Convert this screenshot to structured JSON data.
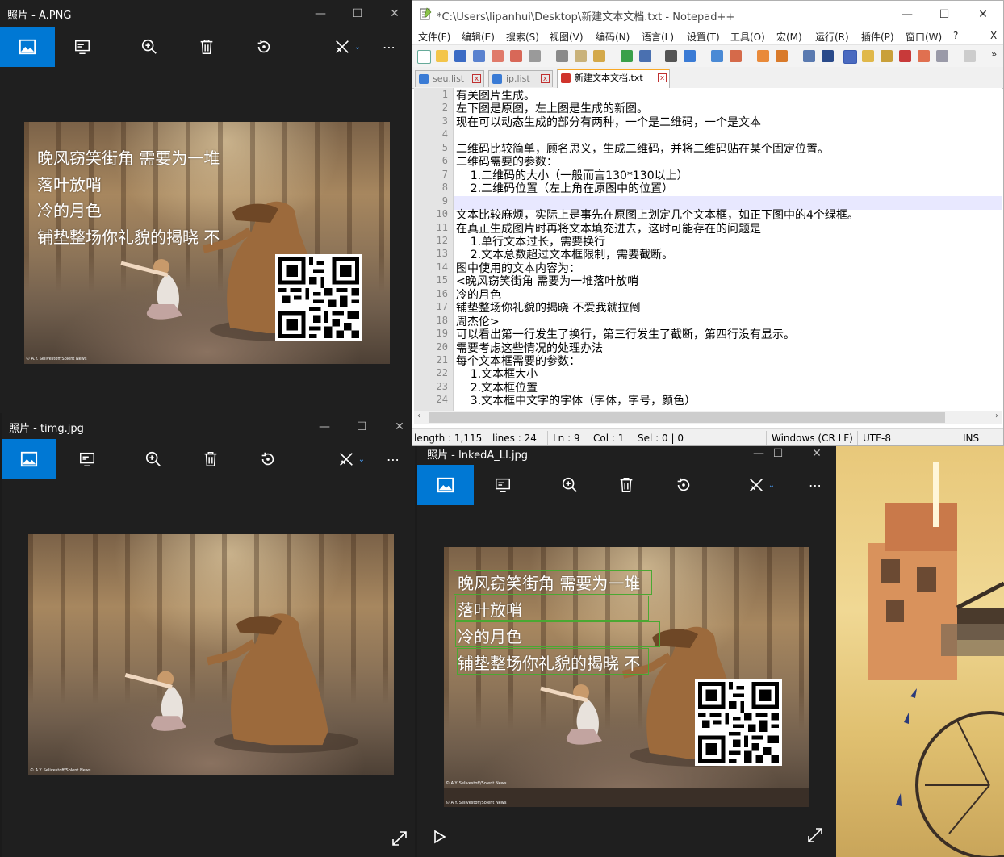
{
  "windows": {
    "photo_a": {
      "title": "照片 - A.PNG",
      "caption_lines": [
        "晚风窃笑街角 需要为一堆",
        "落叶放哨",
        "冷的月色",
        "铺垫整场你礼貌的揭晓 不"
      ],
      "credit": "© A.Y. Selivestoff/Solent News"
    },
    "photo_timg": {
      "title": "照片 - timg.jpg",
      "credit": "© A.Y. Selivestoff/Solent News"
    },
    "photo_inked": {
      "title": "照片 - InkedA_LI.jpg",
      "caption_lines": [
        "晚风窃笑街角 需要为一堆",
        "落叶放哨",
        "冷的月色",
        "铺垫整场你礼貌的揭晓 不"
      ],
      "credit": "© A.Y. Selivestoff/Solent News"
    },
    "window_controls": {
      "minimize": "—",
      "maximize": "☐",
      "close": "✕"
    }
  },
  "toolbar_icons": [
    "image-icon",
    "slideshow-icon",
    "zoom-icon",
    "delete-icon",
    "rotate-icon",
    "edit-icon",
    "more-icon"
  ],
  "notepad": {
    "title": "*C:\\Users\\lipanhui\\Desktop\\新建文本文档.txt - Notepad++",
    "menu": [
      "文件(F)",
      "编辑(E)",
      "搜索(S)",
      "视图(V)",
      "编码(N)",
      "语言(L)",
      "设置(T)",
      "工具(O)",
      "宏(M)",
      "运行(R)",
      "插件(P)",
      "窗口(W)",
      "?"
    ],
    "menu_close": "X",
    "tabs": [
      "seu.list",
      "ip.list",
      "新建文本文档.txt"
    ],
    "lines": [
      "有关图片生成。",
      "左下图是原图，左上图是生成的新图。",
      "现在可以动态生成的部分有两种，一个是二维码，一个是文本",
      "",
      "二维码比较简单，顾名思义，生成二维码，并将二维码贴在某个固定位置。",
      "二维码需要的参数：",
      "    1.二维码的大小（一般而言130*130以上）",
      "    2.二维码位置（左上角在原图中的位置）",
      "",
      "文本比较麻烦，实际上是事先在原图上划定几个文本框，如正下图中的4个绿框。",
      "在真正生成图片时再将文本填充进去，这时可能存在的问题是",
      "    1.单行文本过长，需要换行",
      "    2.文本总数超过文本框限制，需要截断。",
      "图中使用的文本内容为：",
      "<晚风窃笑街角 需要为一堆落叶放哨",
      "冷的月色",
      "铺垫整场你礼貌的揭晓 不爱我就拉倒",
      "周杰伦>",
      "可以看出第一行发生了换行，第三行发生了截断，第四行没有显示。",
      "需要考虑这些情况的处理办法",
      "每个文本框需要的参数：",
      "    1.文本框大小",
      "    2.文本框位置",
      "    3.文本框中文字的字体（字体，字号，颜色）"
    ],
    "line_numbers": [
      "1",
      "2",
      "3",
      "4",
      "5",
      "6",
      "7",
      "8",
      "9",
      "10",
      "11",
      "12",
      "13",
      "14",
      "15",
      "16",
      "17",
      "18",
      "19",
      "20",
      "21",
      "22",
      "23",
      "24"
    ],
    "status": {
      "length": "length : 1,115",
      "lines": "lines : 24",
      "ln": "Ln : 9",
      "col": "Col : 1",
      "sel": "Sel : 0 | 0",
      "eol": "Windows (CR LF)",
      "encoding": "UTF-8",
      "mode": "INS"
    }
  },
  "colors": {
    "accent": "#0078d4",
    "photos_bg": "#1f1f1f",
    "green_box": "#4aa832",
    "tab_active_bar": "#f9a825"
  }
}
